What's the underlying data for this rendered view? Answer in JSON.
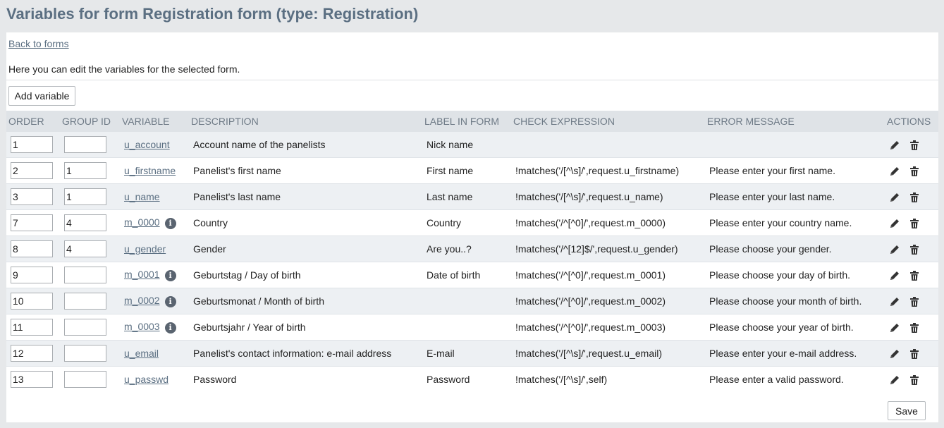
{
  "page": {
    "title": "Variables for form Registration form (type: Registration)",
    "back_link": "Back to forms",
    "intro": "Here you can edit the variables for the selected form.",
    "add_button": "Add variable",
    "save_button": "Save"
  },
  "table": {
    "headers": {
      "order": "ORDER",
      "group_id": "GROUP ID",
      "variable": "VARIABLE",
      "description": "DESCRIPTION",
      "label": "LABEL IN FORM",
      "check": "CHECK EXPRESSION",
      "error": "ERROR MESSAGE",
      "actions": "ACTIONS"
    },
    "rows": [
      {
        "order": "1",
        "group_id": "",
        "variable": "u_account",
        "info": false,
        "description": "Account name of the panelists",
        "label": "Nick name",
        "check": "",
        "error": ""
      },
      {
        "order": "2",
        "group_id": "1",
        "variable": "u_firstname",
        "info": false,
        "description": "Panelist's first name",
        "label": "First name",
        "check": "!matches('/[^\\s]/',request.u_firstname)",
        "error": "Please enter your first name."
      },
      {
        "order": "3",
        "group_id": "1",
        "variable": "u_name",
        "info": false,
        "description": "Panelist's last name",
        "label": "Last name",
        "check": "!matches('/[^\\s]/',request.u_name)",
        "error": "Please enter your last name."
      },
      {
        "order": "7",
        "group_id": "4",
        "variable": "m_0000",
        "info": true,
        "description": "Country",
        "label": "Country",
        "check": "!matches('/^[^0]/',request.m_0000)",
        "error": "Please enter your country name."
      },
      {
        "order": "8",
        "group_id": "4",
        "variable": "u_gender",
        "info": false,
        "description": "Gender",
        "label": "Are you..?",
        "check": "!matches('/^[12]$/',request.u_gender)",
        "error": "Please choose your gender."
      },
      {
        "order": "9",
        "group_id": "",
        "variable": "m_0001",
        "info": true,
        "description": "Geburtstag / Day of birth",
        "label": "Date of birth",
        "check": "!matches('/^[^0]/',request.m_0001)",
        "error": "Please choose your day of birth."
      },
      {
        "order": "10",
        "group_id": "",
        "variable": "m_0002",
        "info": true,
        "description": "Geburtsmonat / Month of birth",
        "label": "",
        "check": "!matches('/^[^0]/',request.m_0002)",
        "error": "Please choose your month of birth."
      },
      {
        "order": "11",
        "group_id": "",
        "variable": "m_0003",
        "info": true,
        "description": "Geburtsjahr / Year of birth",
        "label": "",
        "check": "!matches('/^[^0]/',request.m_0003)",
        "error": "Please choose your year of birth."
      },
      {
        "order": "12",
        "group_id": "",
        "variable": "u_email",
        "info": false,
        "description": "Panelist's contact information: e-mail address",
        "label": "E-mail",
        "check": "!matches('/[^\\s]/',request.u_email)",
        "error": "Please enter your e-mail address."
      },
      {
        "order": "13",
        "group_id": "",
        "variable": "u_passwd",
        "info": false,
        "description": "Password",
        "label": "Password",
        "check": "!matches('/[^\\s]/',self)",
        "error": "Please enter a valid password."
      }
    ]
  },
  "icons": {
    "info": "info-icon",
    "edit": "pencil-icon",
    "delete": "trash-icon"
  },
  "colors": {
    "title": "#5b6f82",
    "header_bg": "#dfe3e7",
    "row_alt_bg": "#edf0f3"
  }
}
